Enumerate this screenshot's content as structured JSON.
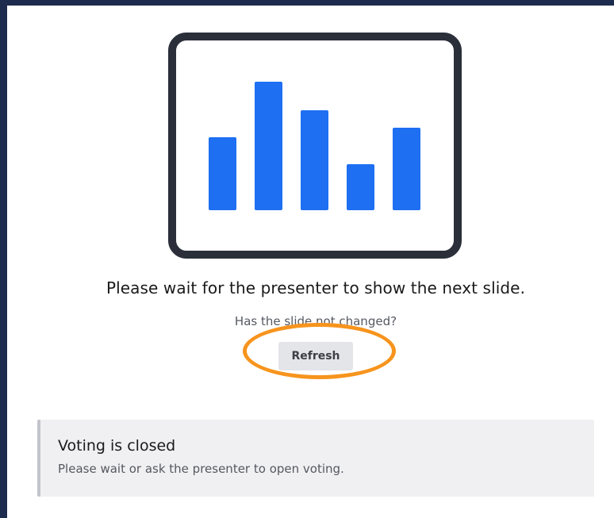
{
  "illustration": {
    "icon": "bar-chart-slide-icon",
    "frame_color": "#2a2f3a",
    "bar_color": "#1e6ff2",
    "bars": [
      0.46,
      0.81,
      0.63,
      0.29,
      0.52
    ]
  },
  "wait_message": "Please wait for the presenter to show the next slide.",
  "hint": "Has the slide not changed?",
  "refresh_label": "Refresh",
  "highlight_color": "#f7941d",
  "voting_alert": {
    "title": "Voting is closed",
    "body": "Please wait or ask the presenter to open voting."
  }
}
